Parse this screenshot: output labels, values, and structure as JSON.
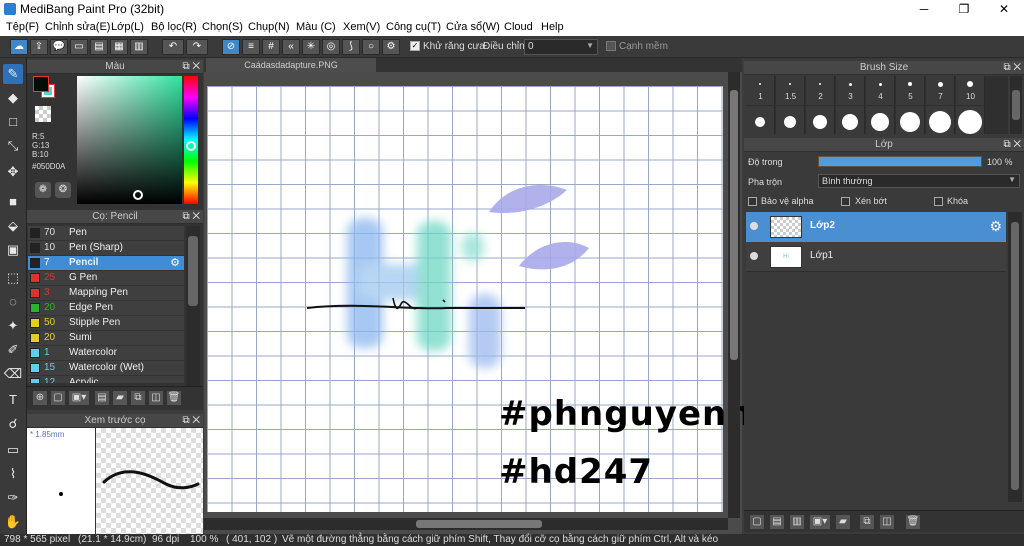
{
  "window": {
    "title": "MediBang Paint Pro (32bit)"
  },
  "menu": [
    "Tệp(F)",
    "Chỉnh sửa(E)",
    "Lớp(L)",
    "Bộ lọc(R)",
    "Chọn(S)",
    "Chụp(N)",
    "Màu (C)",
    "Xem(V)",
    "Công cụ(T)",
    "Cửa sổ(W)",
    "Cloud",
    "Help"
  ],
  "toolbar": {
    "antialias_label": "Khử răng cưa",
    "correction_label": "Điều chỉnh",
    "correction_value": "0",
    "soft_edge_label": "Cạnh mềm"
  },
  "color_panel": {
    "title": "Màu",
    "r": "R:5",
    "g": "G:13",
    "b": "B:10",
    "hex": "#050D0A",
    "main_color": "#050D0A",
    "sub_color": "#59D1D1"
  },
  "brush_panel": {
    "title": "Cọ: Pencil",
    "items": [
      {
        "size": "70",
        "name": "Pen",
        "color": "#222222"
      },
      {
        "size": "10",
        "name": "Pen (Sharp)",
        "color": "#222222"
      },
      {
        "size": "7",
        "name": "Pencil",
        "color": "#222222"
      },
      {
        "size": "25",
        "name": "G Pen",
        "color": "#e03030"
      },
      {
        "size": "3",
        "name": "Mapping Pen",
        "color": "#e03030"
      },
      {
        "size": "20",
        "name": "Edge Pen",
        "color": "#30b030"
      },
      {
        "size": "50",
        "name": "Stipple Pen",
        "color": "#e0d020"
      },
      {
        "size": "20",
        "name": "Sumi",
        "color": "#e0d020"
      },
      {
        "size": "1",
        "name": "Watercolor",
        "color": "#5fd0e8"
      },
      {
        "size": "15",
        "name": "Watercolor (Wet)",
        "color": "#5fd0e8"
      },
      {
        "size": "12",
        "name": "Acrylic",
        "color": "#5fd0e8"
      }
    ]
  },
  "preview_panel": {
    "title": "Xem trước cọ",
    "size": "1.85mm"
  },
  "canvas": {
    "tab_title": "Caádasdadapture.PNG",
    "handwriting_1": "#phnguyenn",
    "handwriting_2": "#hd247"
  },
  "brush_size_panel": {
    "title": "Brush Size",
    "sizes": [
      "1",
      "1.5",
      "2",
      "3",
      "4",
      "5",
      "7",
      "10"
    ]
  },
  "layer_panel": {
    "title": "Lớp",
    "opacity_label": "Độ trong",
    "opacity_value": "100 %",
    "opacity_fraction": 1.0,
    "blend_label": "Pha trộn",
    "blend_value": "Bình thường",
    "protect_alpha": "Bảo vệ alpha",
    "clipping": "Xén bớt",
    "lock": "Khóa",
    "layers": [
      {
        "name": "Lớp2",
        "selected": true
      },
      {
        "name": "Lớp1",
        "selected": false
      }
    ]
  },
  "status": {
    "size": "798 * 565 pixel",
    "cm": "(21.1 * 14.9cm)",
    "dpi": "96 dpi",
    "zoom": "100 %",
    "coords": "( 401, 102 )",
    "hint": "Vẽ một đường thẳng bằng cách giữ phím Shift, Thay đổi cỡ cọ bằng cách giữ phím Ctrl, Alt và kéo"
  }
}
